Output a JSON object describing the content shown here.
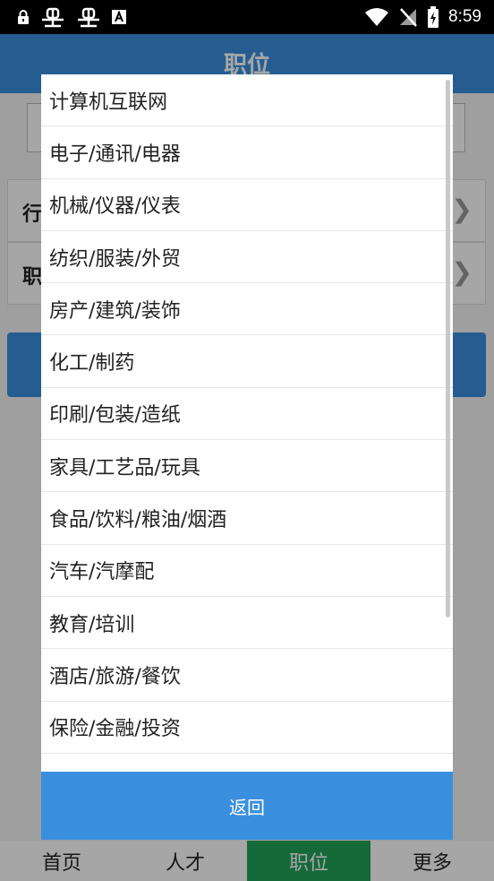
{
  "status_bar": {
    "left_icons": [
      "lock-icon",
      "bug-icon",
      "bug-icon",
      "a-box-icon"
    ],
    "right_icons": [
      "wifi-icon",
      "no-signal-icon",
      "battery-charging-icon"
    ],
    "time": "8:59"
  },
  "background": {
    "title": "职位",
    "rows": [
      {
        "label": "行"
      },
      {
        "label": "职"
      }
    ],
    "bottom_nav": [
      {
        "label": "首页",
        "active": false
      },
      {
        "label": "人才",
        "active": false
      },
      {
        "label": "职位",
        "active": true
      },
      {
        "label": "更多",
        "active": false
      }
    ]
  },
  "dialog": {
    "items": [
      "计算机互联网",
      "电子/通讯/电器",
      "机械/仪器/仪表",
      "纺织/服装/外贸",
      "房产/建筑/装饰",
      "化工/制药",
      "印刷/包装/造纸",
      "家具/工艺品/玩具",
      "食品/饮料/粮油/烟酒",
      "汽车/汽摩配",
      "教育/培训",
      "酒店/旅游/餐饮",
      "保险/金融/投资"
    ],
    "return_label": "返回"
  },
  "colors": {
    "primary": "#3b8fdf",
    "active_nav": "#22a35a"
  }
}
